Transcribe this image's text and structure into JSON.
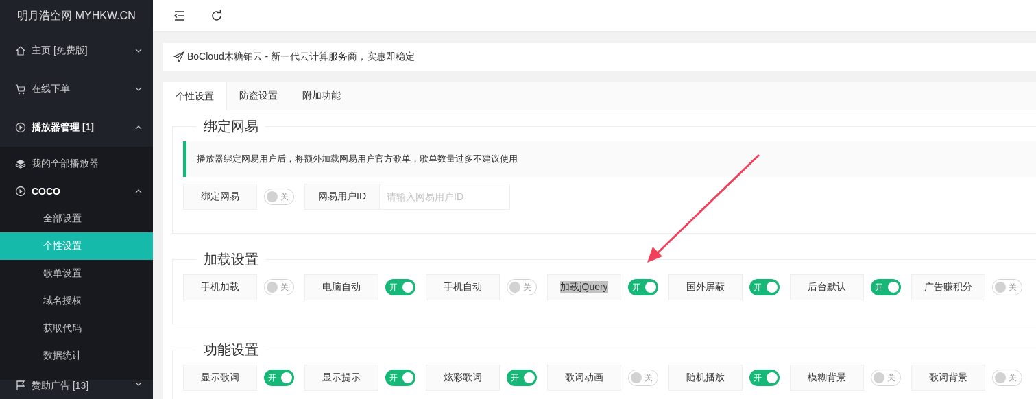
{
  "brand": "明月浩空网 MYHKW.CN",
  "sidebar": {
    "items": [
      {
        "label": "主页 [免费版]",
        "expanded": false
      },
      {
        "label": "在线下单",
        "expanded": false
      },
      {
        "label": "播放器管理 [1]",
        "expanded": true,
        "children": [
          {
            "label": "我的全部播放器"
          },
          {
            "label": "COCO",
            "expanded": true,
            "children": [
              {
                "label": "全部设置",
                "selected": false
              },
              {
                "label": "个性设置",
                "selected": true
              },
              {
                "label": "歌单设置",
                "selected": false
              },
              {
                "label": "域名授权",
                "selected": false
              },
              {
                "label": "获取代码",
                "selected": false
              },
              {
                "label": "数据统计",
                "selected": false
              }
            ]
          }
        ]
      },
      {
        "label": "赞助广告 [13]",
        "expanded": false
      }
    ]
  },
  "notice": {
    "text": "BoCloud木糖铂云 - 新一代云计算服务商，实惠即稳定"
  },
  "tabs": [
    {
      "label": "个性设置",
      "selected": true
    },
    {
      "label": "防盗设置",
      "selected": false
    },
    {
      "label": "附加功能",
      "selected": false
    }
  ],
  "sections": [
    {
      "title": "绑定网易",
      "tip": "播放器绑定网易用户后，将额外加载网易用户官方歌单，歌单数量过多不建议使用",
      "rows": [
        {
          "kind": "switch",
          "label": "绑定网易",
          "on": false,
          "text": "关"
        },
        {
          "kind": "input",
          "label": "网易用户ID",
          "placeholder": "请输入网易用户ID"
        }
      ]
    },
    {
      "title": "加载设置",
      "rows": [
        {
          "kind": "switch",
          "label": "手机加载",
          "on": false,
          "text": "关"
        },
        {
          "kind": "switch",
          "label": "电脑自动",
          "on": true,
          "text": "开"
        },
        {
          "kind": "switch",
          "label": "手机自动",
          "on": false,
          "text": "关"
        },
        {
          "kind": "switch",
          "label": "加载jQuery",
          "on": true,
          "highlighted": true,
          "text": "开"
        },
        {
          "kind": "switch",
          "label": "国外屏蔽",
          "on": true,
          "text": "开"
        },
        {
          "kind": "switch",
          "label": "后台默认",
          "on": true,
          "text": "开"
        },
        {
          "kind": "switch",
          "label": "广告赚积分",
          "on": false,
          "text": "关"
        }
      ]
    },
    {
      "title": "功能设置",
      "rows": [
        {
          "kind": "switch",
          "label": "显示歌词",
          "on": true,
          "text": "开"
        },
        {
          "kind": "switch",
          "label": "显示提示",
          "on": true,
          "text": "开"
        },
        {
          "kind": "switch",
          "label": "炫彩歌词",
          "on": true,
          "text": "开"
        },
        {
          "kind": "switch",
          "label": "歌词动画",
          "on": false,
          "text": "关"
        },
        {
          "kind": "switch",
          "label": "随机播放",
          "on": true,
          "text": "开"
        },
        {
          "kind": "switch",
          "label": "模糊背景",
          "on": false,
          "text": "关"
        },
        {
          "kind": "switch",
          "label": "歌词背景",
          "on": false,
          "text": "关"
        }
      ]
    }
  ]
}
